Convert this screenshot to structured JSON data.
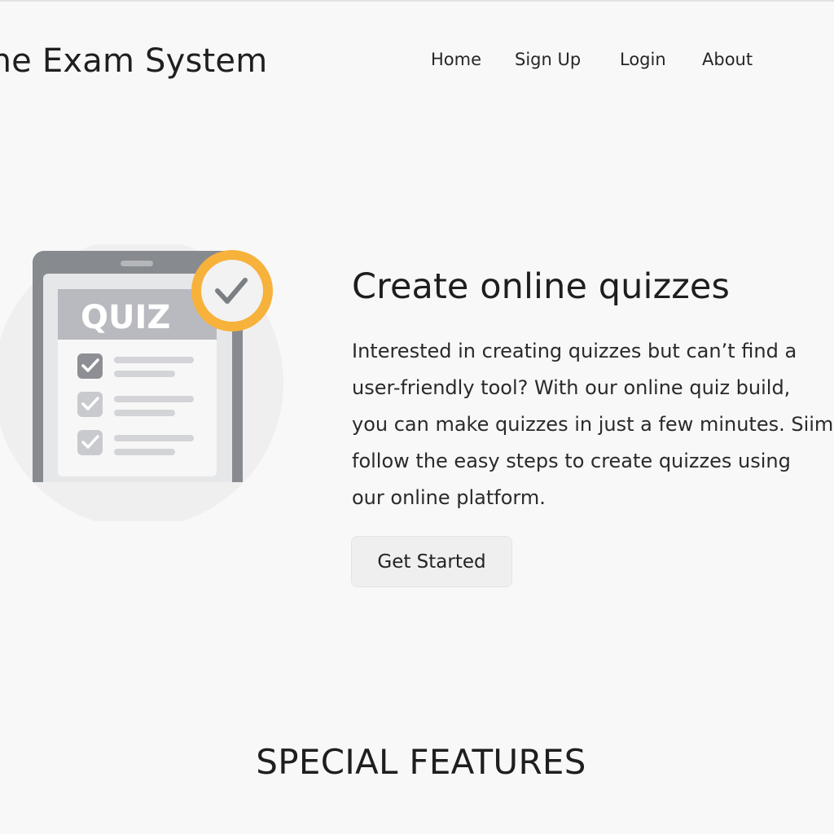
{
  "header": {
    "site_title": "line Exam System",
    "nav": {
      "home": "Home",
      "signup": "Sign Up",
      "login": "Login",
      "about": "About"
    }
  },
  "hero": {
    "illustration": {
      "badge_text": "QUIZ",
      "icons": [
        "tablet-icon",
        "checkmark-icon",
        "checkbox-icon"
      ],
      "accent_color": "#f7b23b"
    },
    "heading": "Create online quizzes",
    "text_lines": [
      "Interested in creating quizzes but can’t find a",
      "user-friendly tool? With our online quiz build,",
      "you can make quizzes in just a few minutes. Siim",
      "follow the easy steps to create quizzes using",
      "our online platform."
    ],
    "cta_label": "Get Started"
  },
  "features": {
    "heading": "SPECIAL FEATURES"
  }
}
